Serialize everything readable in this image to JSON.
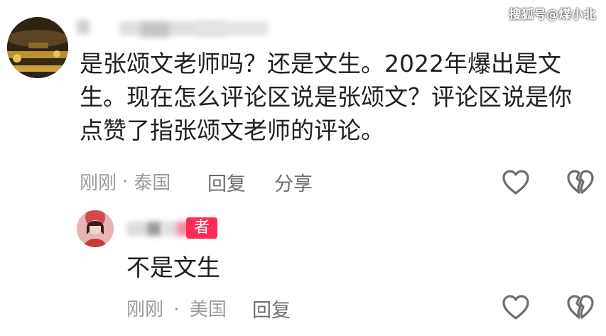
{
  "watermark": "搜狐号@煤小北",
  "comment": {
    "text": "是张颂文老师吗？还是文生。2022年爆出是文生。现在怎么评论区说是张颂文？评论区说是你点赞了指张颂文老师的评论。",
    "time": "刚刚",
    "separator": "·",
    "location": "泰国",
    "reply_label": "回复",
    "share_label": "分享",
    "icons": {
      "like": "heart-outline-icon",
      "dislike": "broken-heart-icon"
    }
  },
  "reply": {
    "badge": "者",
    "badge_color": "#fe2c55",
    "text": "不是文生",
    "time": "刚刚",
    "separator": "·",
    "location": "美国",
    "reply_label": "回复",
    "icons": {
      "like": "heart-outline-icon",
      "dislike": "broken-heart-icon"
    }
  }
}
